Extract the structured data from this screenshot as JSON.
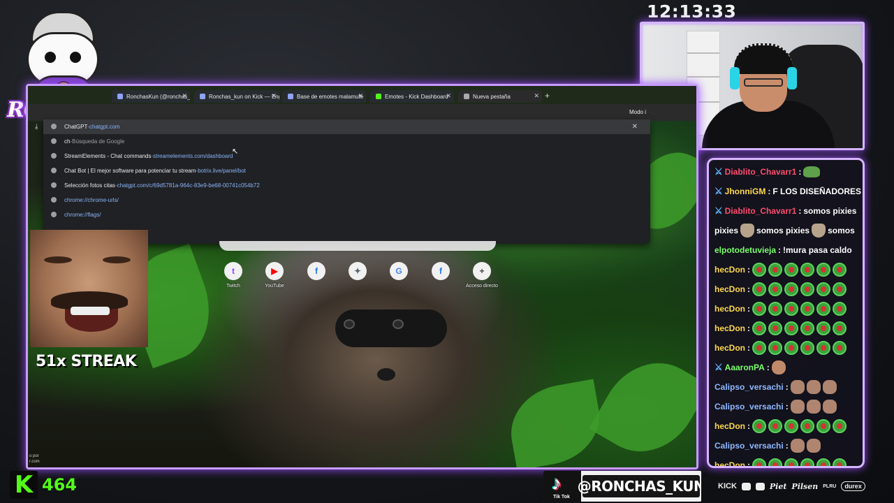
{
  "clock": "12:13:33",
  "logo": {
    "text": "RONCHAS"
  },
  "browser": {
    "tabs": [
      {
        "label": "RonchasKun (@ronchas_kun) |"
      },
      {
        "label": "Ronchas_kun on Kick — Engag"
      },
      {
        "label": "Base de emotes malamute"
      },
      {
        "label": "Emotes - Kick Dashboard"
      },
      {
        "label": "Nueva pestaña"
      }
    ],
    "new_tab": "+",
    "mode_label": "Modo i",
    "omnibox_suggestions": [
      {
        "title": "ChatGPT",
        "sep": " - ",
        "url": "chatgpt.com",
        "active": true
      },
      {
        "title": "ch",
        "sep": " - ",
        "dim": "Búsqueda de Google"
      },
      {
        "title": "StreamElements - Chat commands",
        "sep": " - ",
        "url": "streamelements.com/dashboard"
      },
      {
        "title": "Chat Bot | El mejor software para potenciar tu stream",
        "sep": " - ",
        "url": "botrix.live/panel/bot"
      },
      {
        "title": "Selección fotos citas",
        "sep": " - ",
        "url": "chatgpt.com/c/69d5781a-964c-83e9-be68-00741c054b72"
      },
      {
        "title": "",
        "sep": "",
        "url": "chrome://chrome-urls/"
      },
      {
        "title": "",
        "sep": "",
        "url": "chrome://flags/"
      }
    ],
    "shortcuts": [
      {
        "label": "Twitch",
        "glyph": "t",
        "color": "#9146ff"
      },
      {
        "label": "YouTube",
        "glyph": "▶",
        "color": "#ff0000"
      },
      {
        "label": "",
        "glyph": "f",
        "color": "#1877f2"
      },
      {
        "label": "",
        "glyph": "✦",
        "color": "#5f6368"
      },
      {
        "label": "",
        "glyph": "G",
        "color": "#4285f4"
      },
      {
        "label": "",
        "glyph": "f",
        "color": "#1877f2"
      },
      {
        "label": "Acceso directo",
        "glyph": "+",
        "color": "#444"
      }
    ],
    "credit": "o por\nr.com"
  },
  "streak": {
    "text": "51x STREAK"
  },
  "chat": {
    "messages": [
      {
        "user": "Diablito_Chavarr1",
        "color": "#ff4d6d",
        "mod": true,
        "text": "",
        "emotes": [
          "pepe"
        ]
      },
      {
        "user": "JhonniGM",
        "color": "#ffd94a",
        "mod": true,
        "text": "F LOS DISEÑADORES",
        "emotes": []
      },
      {
        "user": "Diablito_Chavarr1",
        "color": "#ff4d6d",
        "mod": true,
        "text": "somos pixies",
        "emotes": []
      },
      {
        "user": "",
        "color": "#fff",
        "mod": false,
        "text": "pixies",
        "emotes": [
          "cat"
        ],
        "text2": "somos pixies",
        "emotes2": [
          "cat"
        ],
        "text3": "somos"
      },
      {
        "user": "elpotodetuvieja",
        "color": "#7bff6b",
        "mod": false,
        "text": "!mura pasa caldo",
        "emotes": []
      },
      {
        "user": "hecDon",
        "color": "#ffd94a",
        "mod": false,
        "text": "",
        "emotes": [
          "jp",
          "jp",
          "jp",
          "jp",
          "jp",
          "jp"
        ]
      },
      {
        "user": "hecDon",
        "color": "#ffd94a",
        "mod": false,
        "text": "",
        "emotes": [
          "jp",
          "jp",
          "jp",
          "jp",
          "jp",
          "jp"
        ]
      },
      {
        "user": "hecDon",
        "color": "#ffd94a",
        "mod": false,
        "text": "",
        "emotes": [
          "jp",
          "jp",
          "jp",
          "jp",
          "jp",
          "jp"
        ]
      },
      {
        "user": "hecDon",
        "color": "#ffd94a",
        "mod": false,
        "text": "",
        "emotes": [
          "jp",
          "jp",
          "jp",
          "jp",
          "jp",
          "jp"
        ]
      },
      {
        "user": "hecDon",
        "color": "#ffd94a",
        "mod": false,
        "text": "",
        "emotes": [
          "jp",
          "jp",
          "jp",
          "jp",
          "jp",
          "jp"
        ]
      },
      {
        "user": "AaaronPA",
        "color": "#7bff6b",
        "mod": true,
        "text": "",
        "emotes": [
          "face"
        ]
      },
      {
        "user": "Calipso_versachi",
        "color": "#8fb8ff",
        "mod": false,
        "text": "",
        "emotes": [
          "man",
          "man",
          "man"
        ]
      },
      {
        "user": "Calipso_versachi",
        "color": "#8fb8ff",
        "mod": false,
        "text": "",
        "emotes": [
          "man",
          "man",
          "man"
        ]
      },
      {
        "user": "hecDon",
        "color": "#ffd94a",
        "mod": false,
        "text": "",
        "emotes": [
          "jp",
          "jp",
          "jp",
          "jp",
          "jp",
          "jp"
        ]
      },
      {
        "user": "Calipso_versachi",
        "color": "#8fb8ff",
        "mod": false,
        "text": "",
        "emotes": [
          "man",
          "man"
        ]
      },
      {
        "user": "hecDon",
        "color": "#ffd94a",
        "mod": false,
        "text": "",
        "emotes": [
          "jp",
          "jp",
          "jp",
          "jp",
          "jp",
          "jp"
        ]
      }
    ]
  },
  "kick": {
    "icon": "K",
    "viewers": "464"
  },
  "tiktok": {
    "label": "Tik Tok",
    "handle": "@RONCHAS_KUN"
  },
  "sponsors": [
    "KICK",
    "Piet",
    "Pilsen",
    "PLRU",
    "durex"
  ]
}
